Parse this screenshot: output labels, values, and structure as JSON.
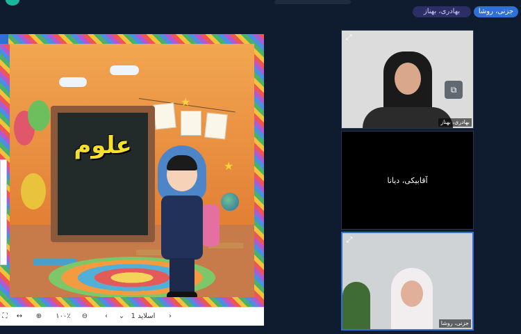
{
  "top_bar": {
    "active_participant": "جزنی، روشا",
    "other_participant": "بهادری، بهناز"
  },
  "slide": {
    "board_text": "علوم"
  },
  "slide_toolbar": {
    "fit_icon": "⛶",
    "resize_icon": "↔",
    "zoom_in_icon": "⊕",
    "zoom_level": "۱۰۰٪",
    "zoom_out_icon": "⊖",
    "prev_icon": "‹",
    "slide_selector": "اسلاید 1",
    "dropdown_icon": "⌄",
    "next_icon": "›"
  },
  "videos": [
    {
      "name": "بهادری، بهناز",
      "expand_icon": "⤢",
      "pin_icon": "⧉"
    },
    {
      "name": "آقابیکی، دیانا"
    },
    {
      "name": "جزنی، روشا",
      "expand_icon": "⤢"
    }
  ],
  "colors": {
    "accent": "#2f6fd8",
    "background": "#0f1b2e",
    "board": "#232b2a",
    "board_text": "#f6e02a"
  }
}
